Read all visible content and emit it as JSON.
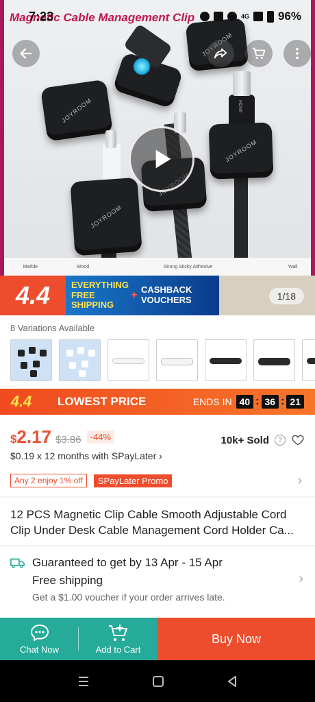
{
  "status_bar": {
    "time": "7:23",
    "battery": "96%",
    "network": "4G"
  },
  "hero": {
    "overlay_title": "Magnetic Cable Management Clip",
    "brand_text": "JOYROOM",
    "plug_text": "HDMI",
    "thumb_captions": [
      "Marble",
      "Wood",
      "",
      "Strong Sticky Adhesive",
      "",
      "Wall"
    ],
    "image_counter": "1/18"
  },
  "promo_banner": {
    "sale_label": "4.4",
    "left_text": "EVERYTHING FREE SHIPPING",
    "plus": "+",
    "right_text": "CASHBACK VOUCHERS"
  },
  "variations": {
    "label": "8 Variations Available",
    "items": [
      "black-set",
      "white-set",
      "white-strip-small",
      "white-strip-large",
      "black-strip-small",
      "black-strip-large",
      "partial"
    ]
  },
  "flash_sale": {
    "badge": "4.4",
    "label": "LOWEST PRICE",
    "ends_label": "ENDS IN",
    "hours": "40",
    "minutes": "36",
    "seconds": "21"
  },
  "pricing": {
    "currency": "$",
    "price": "2.17",
    "original": "$3.86",
    "discount": "-44%",
    "sold": "10k+ Sold",
    "installment": "$0.19 x 12 months with SPayLater ›"
  },
  "tags": {
    "bundle": "Any 2 enjoy 1% off",
    "promo": "SPayLater Promo"
  },
  "product_title": "12 PCS Magnetic Clip Cable Smooth Adjustable Cord Clip Under Desk Cable Management Cord Holder Ca...",
  "shipping": {
    "guarantee": "Guaranteed to get by 13 Apr - 15 Apr",
    "free": "Free shipping",
    "voucher": "Get a $1.00 voucher if your order arrives late."
  },
  "bottom_bar": {
    "chat": "Chat Now",
    "cart": "Add to Cart",
    "buy": "Buy Now"
  },
  "colors": {
    "brand_orange": "#ee4d2d",
    "teal": "#26aa99",
    "magenta_frame": "#a8195a"
  }
}
